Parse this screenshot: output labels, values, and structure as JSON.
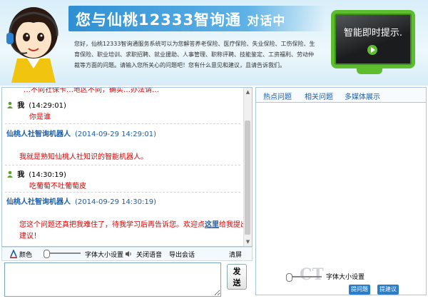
{
  "banner": {
    "title": "您与仙桃12333智询通",
    "title_suffix": "对话中",
    "intro": "您好，仙桃12333智询通服务系统可以为您解答养老保险、医疗保险、失业保险、工伤保险、生育保险、职业培训、求职招聘、就业援助、人事管理、职称评聘、技能鉴定、工资福利、劳动仲裁等方面的问题。请输入您所关心的问题吧！您有什么意见和建议，且请告诉我们。",
    "tv_text": "智能即时提示."
  },
  "chat": {
    "cut_top": "…不同社保卡…地区不同，确实…办法请…",
    "messages": [
      {
        "sender": "我",
        "time": "(14:29:01)",
        "text": "你是谁"
      },
      {
        "sender": "仙桃人社智询机器人",
        "time": "(2014-09-29 14:29:01)",
        "text": "我就是熟知仙桃人社知识的智能机器人。"
      },
      {
        "sender": "我",
        "time": "(14:30:19)",
        "text": "吃葡萄不吐葡萄皮"
      },
      {
        "sender": "仙桃人社智询机器人",
        "time": "(2014-09-29 14:30:19)",
        "text_a": "您这个问题还真把我难住了，待我学习后再告诉您。欢迎点",
        "link": "这里",
        "text_b": "给我提出",
        "text_c": "建议！"
      }
    ]
  },
  "toolbar": {
    "color": "颜色",
    "font_size": "字体大小设置",
    "close_voice": "关闭语音",
    "export": "导出会话",
    "clear": "清屏"
  },
  "input": {
    "placeholder": ""
  },
  "send_button": {
    "line1": "发",
    "line2": "送"
  },
  "right_panel": {
    "tabs": [
      "热点问题",
      "相关问题",
      "多媒体展示"
    ],
    "font_size": "字体大小设置",
    "ask_button": "提问题",
    "suggest_button": "提建议"
  },
  "watermark": "CT",
  "colors": {
    "accent": "#1a5ea8",
    "bot_text": "#d00000",
    "tv_frame": "#5ebd2e"
  }
}
